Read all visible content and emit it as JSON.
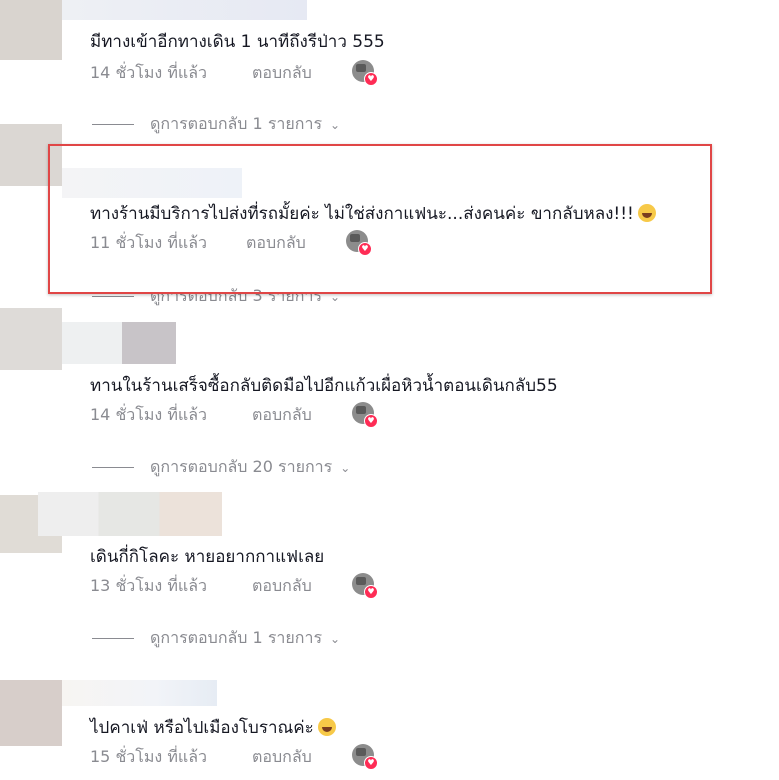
{
  "comments": [
    {
      "text": "มีทางเข้าอีกทางเดิน 1 นาทีถึงรีป่าว 555",
      "time": "14 ชั่วโมง ที่แล้ว",
      "reply_label": "ตอบกลับ",
      "view_replies": "ดูการตอบกลับ 1 รายการ"
    },
    {
      "text": "ทางร้านมีบริการไปส่งที่รถมั้ยค่ะ ไม่ใช่ส่งกาแฟนะ...ส่งคนค่ะ ขากลับหลง!!!",
      "emoji": "grinning-sweat-emoji",
      "time": "11 ชั่วโมง ที่แล้ว",
      "reply_label": "ตอบกลับ",
      "view_replies": "ดูการตอบกลับ 3 รายการ"
    },
    {
      "text": "ทานในร้านเสร็จซื้อกลับติดมือไปอีกแก้วเผื่อหิวน้ำตอนเดินกลับ55",
      "time": "14 ชั่วโมง ที่แล้ว",
      "reply_label": "ตอบกลับ",
      "view_replies": "ดูการตอบกลับ 20 รายการ"
    },
    {
      "text": "เดินกี่กิโลคะ หายอยากกาแฟเลย",
      "time": "13 ชั่วโมง ที่แล้ว",
      "reply_label": "ตอบกลับ",
      "view_replies": "ดูการตอบกลับ 1 รายการ"
    },
    {
      "text": "ไปคาเฟ่ หรือไปเมืองโบราณค่ะ",
      "emoji": "grinning-sweat-emoji",
      "time": "15 ชั่วโมง ที่แล้ว",
      "reply_label": "ตอบกลับ"
    }
  ],
  "colors": {
    "highlight_border": "#e04646",
    "secondary_text": "#8a8b91",
    "heart": "#fe2c55"
  }
}
